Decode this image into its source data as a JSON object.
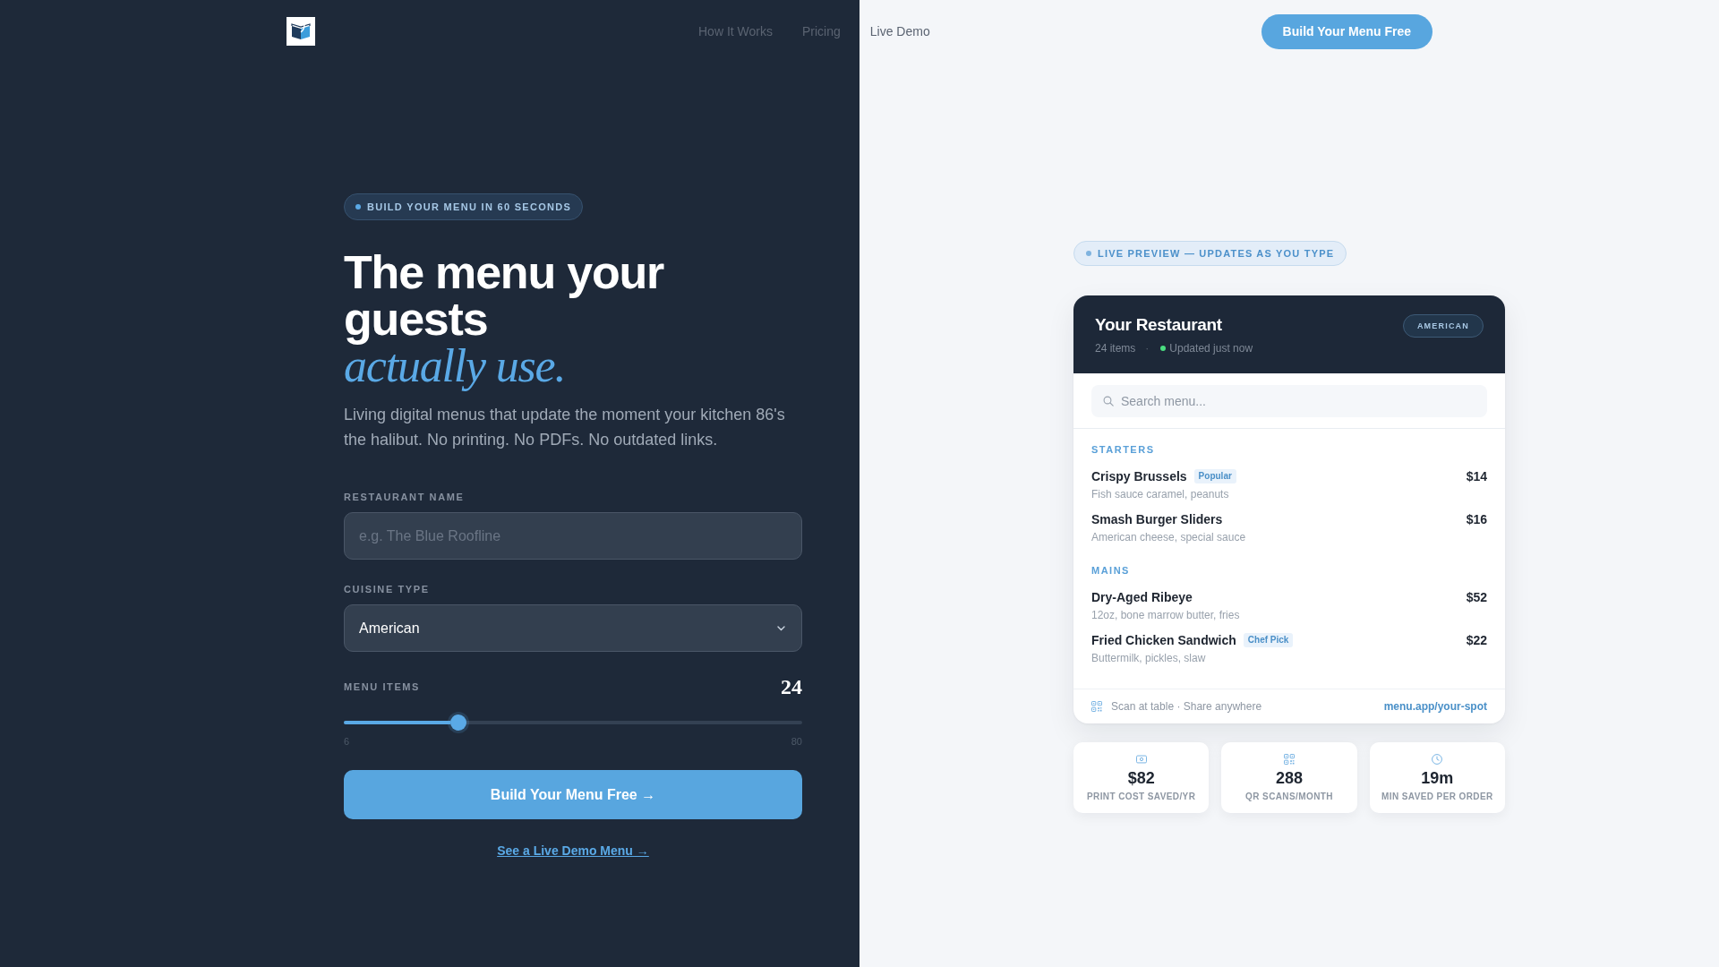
{
  "nav": {
    "links": [
      {
        "label": "How It Works"
      },
      {
        "label": "Pricing"
      },
      {
        "label": "Live Demo"
      }
    ],
    "cta": "Build Your Menu Free"
  },
  "hero": {
    "badge": "BUILD YOUR MENU IN 60 SECONDS",
    "headline": "The menu your guests *actually use.*",
    "subtitle": "Living digital menus that update the moment your kitchen 86's the halibut. No printing. No PDFs. No outdated links."
  },
  "form": {
    "fields": [
      {
        "kind": "text",
        "label": "RESTAURANT NAME",
        "placeholder": "e.g. The Blue Roofline"
      },
      {
        "kind": "select",
        "label": "CUISINE TYPE",
        "value": "American"
      },
      {
        "kind": "slider",
        "label": "MENU ITEMS",
        "reading": "24",
        "level": 0.24,
        "min_label": "6",
        "max_label": "80"
      }
    ],
    "submit": "Build Your Menu Free →",
    "demo_link": "See a Live Demo Menu →"
  },
  "preview": {
    "badge": "LIVE PREVIEW — UPDATES AS YOU TYPE",
    "menu": {
      "title": "Your Restaurant",
      "item_count": "24 items",
      "separator": "·",
      "status": "Updated just now",
      "cuisine": "AMERICAN",
      "search_placeholder": "Search menu...",
      "sections": [
        {
          "title": "STARTERS",
          "items": [
            {
              "name": "Crispy Brussels",
              "tag": "Popular",
              "description": "Fish sauce caramel, peanuts",
              "price": "$14"
            },
            {
              "name": "Smash Burger Sliders",
              "description": "American cheese, special sauce",
              "price": "$16"
            }
          ]
        },
        {
          "title": "MAINS",
          "items": [
            {
              "name": "Dry-Aged Ribeye",
              "description": "12oz, bone marrow butter, fries",
              "price": "$52"
            },
            {
              "name": "Fried Chicken Sandwich",
              "tag": "Chef Pick",
              "description": "Buttermilk, pickles, slaw",
              "price": "$22"
            }
          ]
        }
      ],
      "footer_note": "Scan at table · Share anywhere",
      "link": "menu.app/your-spot"
    },
    "stats": [
      {
        "kind": "money",
        "value": "$82",
        "label": "PRINT COST SAVED/YR"
      },
      {
        "kind": "qr",
        "value": "288",
        "label": "QR SCANS/MONTH"
      },
      {
        "kind": "clock",
        "value": "19m",
        "label": "MIN SAVED PER ORDER"
      }
    ]
  }
}
